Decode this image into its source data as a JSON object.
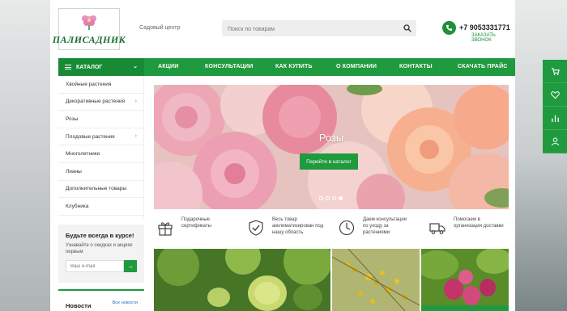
{
  "header": {
    "logo_text": "ПАЛИСАДНИК",
    "tagline": "Садовый центр",
    "search_placeholder": "Поиск по товарам",
    "phone": "+7 9053331771",
    "callback": "ЗАКАЗАТЬ ЗВОНОК"
  },
  "nav": {
    "catalog": "КАТАЛОГ",
    "items": [
      "АКЦИИ",
      "КОНСУЛЬТАЦИИ",
      "КАК КУПИТЬ",
      "О КОМПАНИИ",
      "КОНТАКТЫ",
      "СКАЧАТЬ ПРАЙС"
    ]
  },
  "sidebar": {
    "items": [
      {
        "label": "Хвойные растения",
        "has_sub": false
      },
      {
        "label": "Декоративные растения",
        "has_sub": true
      },
      {
        "label": "Розы",
        "has_sub": false
      },
      {
        "label": "Плодовые растения",
        "has_sub": true
      },
      {
        "label": "Многолетники",
        "has_sub": false
      },
      {
        "label": "Лианы",
        "has_sub": false
      },
      {
        "label": "Дополнительные товары",
        "has_sub": false
      },
      {
        "label": "Клубника",
        "has_sub": false
      }
    ]
  },
  "subscribe": {
    "title": "Будьте всегда в курсе!",
    "text": "Узнавайте о скидках и акциях первым",
    "placeholder": "Ваш e-mail"
  },
  "news": {
    "title": "Новости",
    "all": "Все новости"
  },
  "banner": {
    "title": "Розы",
    "button": "Перейти в каталог",
    "slides": 4,
    "active_slide": 4
  },
  "features": [
    {
      "icon": "gift-icon",
      "text": "Подарочные сертификаты"
    },
    {
      "icon": "shield-check-icon",
      "text": "Весь товар акклиматизирован под нашу область"
    },
    {
      "icon": "clock-icon",
      "text": "Даем консультации по уходу за растениями"
    },
    {
      "icon": "truck-icon",
      "text": "Помогаем в организации доставки"
    }
  ],
  "colors": {
    "brand_green": "#1f9a3e",
    "dark_green": "#188a35"
  },
  "right_bar": [
    "cart-icon",
    "heart-icon",
    "compare-icon",
    "user-icon"
  ]
}
